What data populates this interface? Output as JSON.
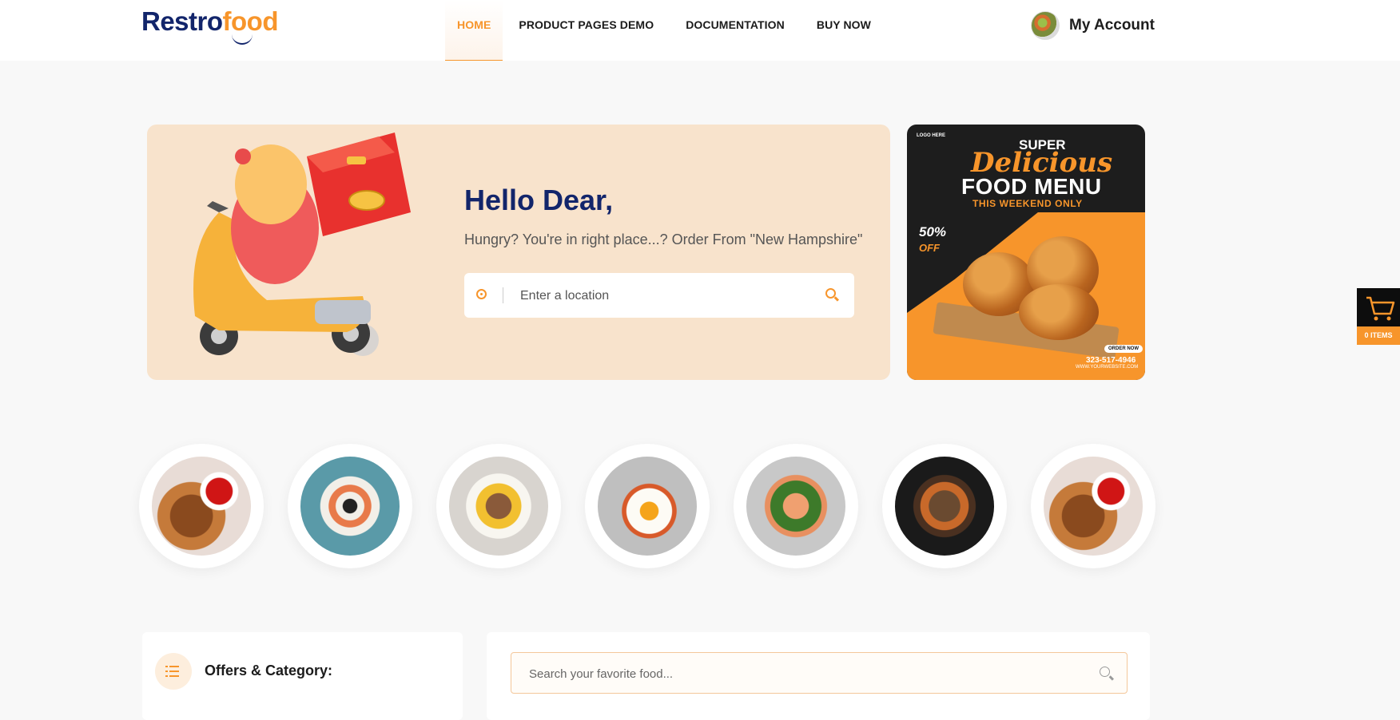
{
  "header": {
    "logo": {
      "part1": "Restro",
      "part2": "food"
    },
    "nav": [
      {
        "label": "HOME",
        "active": true
      },
      {
        "label": "PRODUCT PAGES DEMO",
        "active": false
      },
      {
        "label": "DOCUMENTATION",
        "active": false
      },
      {
        "label": "BUY NOW",
        "active": false
      }
    ],
    "account_label": "My Account"
  },
  "hero": {
    "title": "Hello Dear,",
    "subtitle": "Hungry? You're in right place...? Order From \"New Hampshire\"",
    "location_placeholder": "Enter a location"
  },
  "banner": {
    "logo_text": "LOGO HERE",
    "super": "SUPER",
    "delicious": "Delicious",
    "food_menu": "FOOD MENU",
    "weekend": "THIS WEEKEND ONLY",
    "discount": "50%",
    "off": "OFF",
    "order_now": "ORDER NOW",
    "phone": "323-517-4946",
    "website": "WWW.YOURWEBSITE.COM"
  },
  "cart": {
    "items_label": "0 ITEMS"
  },
  "food_items": [
    {
      "name": "grilled-chicken-with-sauce"
    },
    {
      "name": "sushi-platter"
    },
    {
      "name": "deviled-eggs"
    },
    {
      "name": "fried-egg-breakfast"
    },
    {
      "name": "shrimp-broccoli"
    },
    {
      "name": "beef-stir-fry"
    },
    {
      "name": "grilled-chicken-with-sauce"
    }
  ],
  "offers": {
    "title": "Offers & Category:"
  },
  "food_search": {
    "placeholder": "Search your favorite food..."
  },
  "colors": {
    "accent": "#f7952b",
    "navy": "#12256b",
    "hero_bg": "#f8e3cc"
  }
}
